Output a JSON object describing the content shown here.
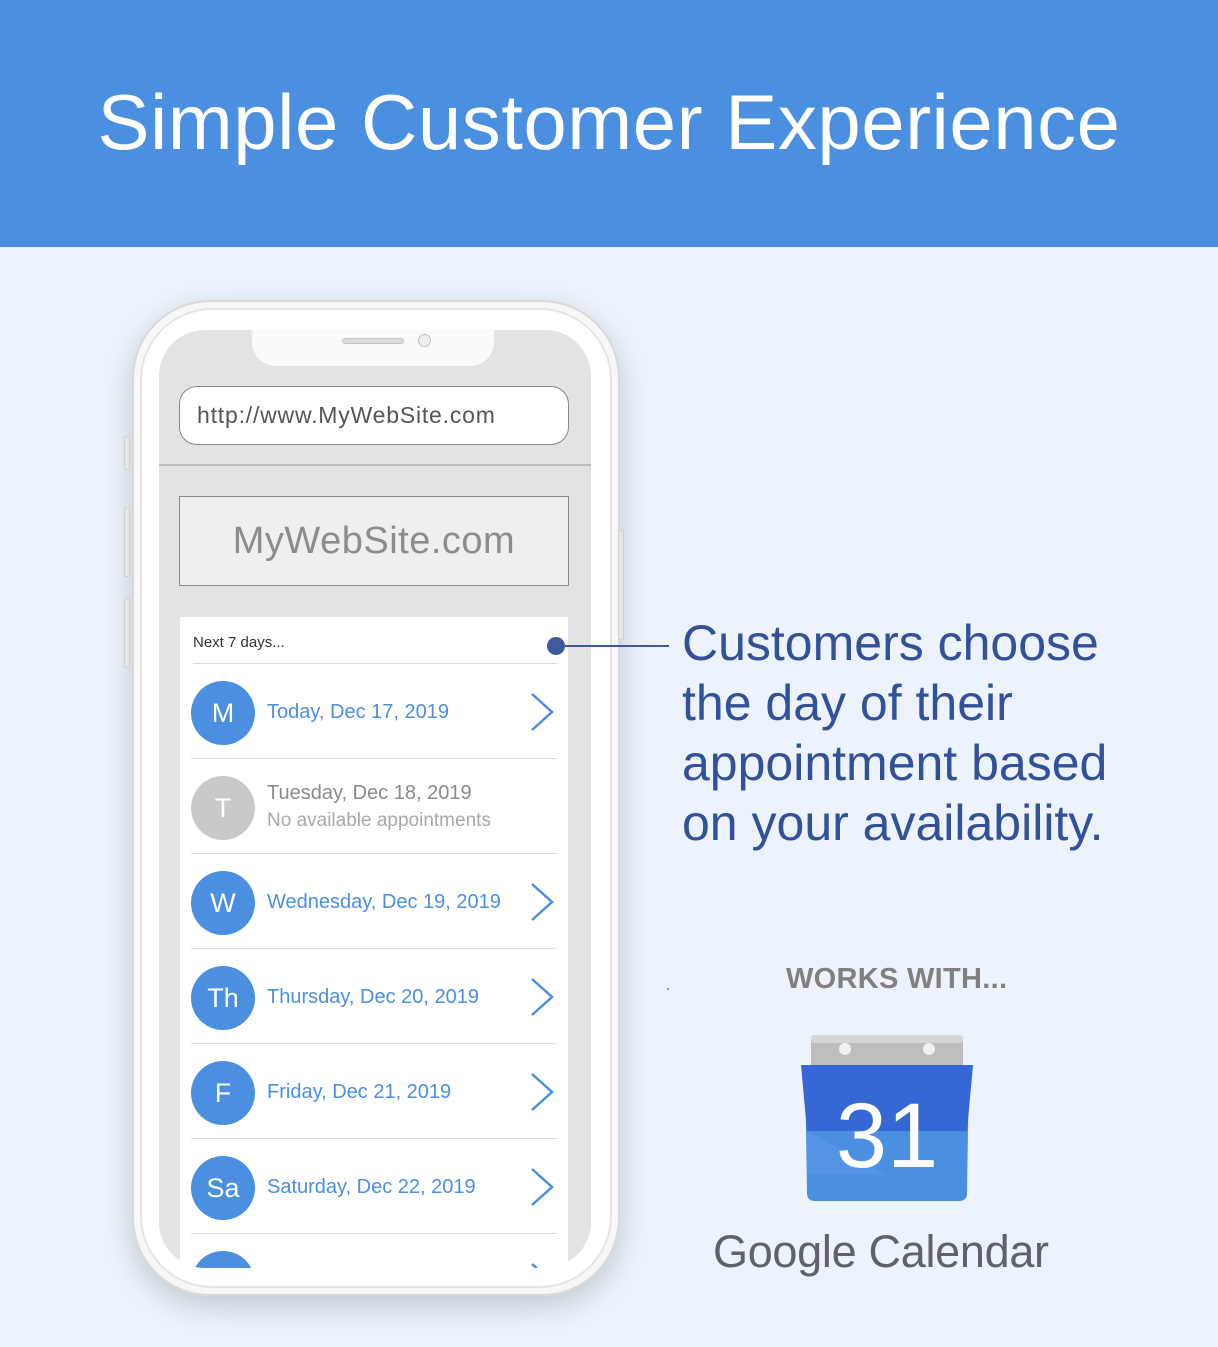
{
  "header": {
    "title": "Simple Customer Experience"
  },
  "phone": {
    "url": "http://www.MyWebSite.com",
    "site_name": "MyWebSite.com",
    "list_heading": "Next 7 days...",
    "days": [
      {
        "initial": "M",
        "label": "Today, Dec 17, 2019",
        "available": true
      },
      {
        "initial": "T",
        "label": "Tuesday, Dec 18, 2019",
        "available": false,
        "note": "No available appointments"
      },
      {
        "initial": "W",
        "label": "Wednesday, Dec 19, 2019",
        "available": true
      },
      {
        "initial": "Th",
        "label": "Thursday, Dec 20, 2019",
        "available": true
      },
      {
        "initial": "F",
        "label": "Friday, Dec 21, 2019",
        "available": true
      },
      {
        "initial": "Sa",
        "label": "Saturday, Dec 22, 2019",
        "available": true
      }
    ]
  },
  "callout": {
    "lines": [
      "Customers choose",
      "the day of their",
      "appointment based",
      "on your availability."
    ]
  },
  "integration": {
    "works_with": "WORKS WITH...",
    "calendar_day": "31",
    "brand_google": "Google",
    "brand_product": "Calendar"
  },
  "colors": {
    "header_bg": "#4a8fe0",
    "page_bg": "#ecf3fc",
    "accent": "#4a8fe0",
    "callout_text": "#33509a",
    "unavailable": "#c9c9c9"
  }
}
